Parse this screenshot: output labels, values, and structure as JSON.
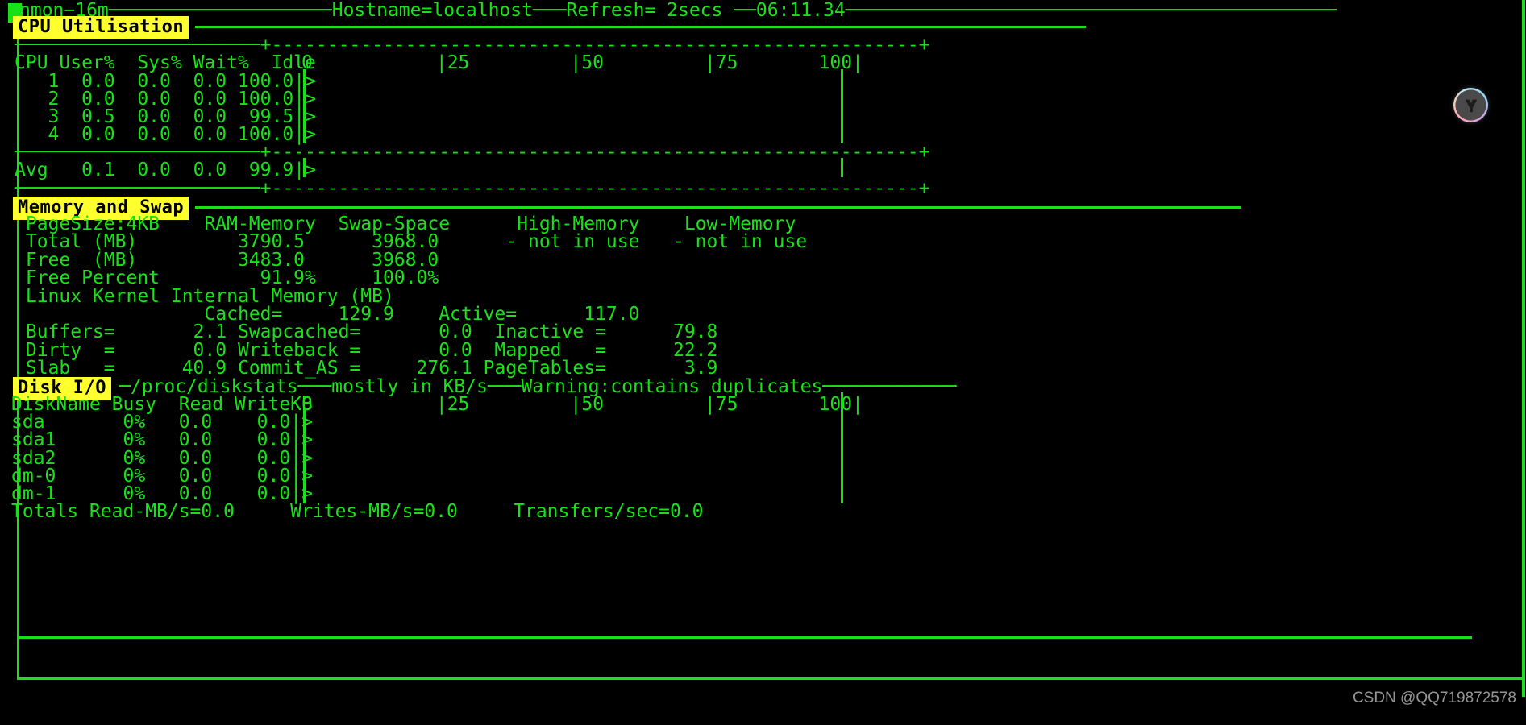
{
  "app": {
    "name": "nmon",
    "version_label": "nmon−16m",
    "header_line": "nmon−16m────────────────────Hostname=localhost───Refresh= 2secs ──06:11.34────────────────────────────────────────────",
    "hostname_label": "Hostname=localhost",
    "refresh_label": "Refresh= 2secs",
    "clock_label": "06:11.34",
    "colors": {
      "foreground": "#18e118",
      "background": "#000000",
      "banner_bg": "#ffff2e",
      "banner_fg": "#000000",
      "watermark": "#cfcfcf"
    }
  },
  "cpu_section": {
    "banner": "CPU Utilisation",
    "divider": "──────────────────────+----------------------------------------------------------+",
    "dashes_left": "----------------------+",
    "dashes_right": "-----------------------------------------------------------+",
    "header_cols": "CPU User%  Sys% Wait%  Idle",
    "scale_labels": [
      "0",
      "|25",
      "|50",
      "|75",
      "100|"
    ],
    "rows": [
      {
        "cpu": "   1",
        "user": "  0.0",
        "sys": "  0.0",
        "wait": "  0.0",
        "idle": " 100.0",
        "bar": ">"
      },
      {
        "cpu": "   2",
        "user": "  0.0",
        "sys": "  0.0",
        "wait": "  0.0",
        "idle": " 100.0",
        "bar": ">"
      },
      {
        "cpu": "   3",
        "user": "  0.5",
        "sys": "  0.0",
        "wait": "  0.0",
        "idle": "  99.5",
        "bar": ">"
      },
      {
        "cpu": "   4",
        "user": "  0.0",
        "sys": "  0.0",
        "wait": "  0.0",
        "idle": " 100.0",
        "bar": ">"
      }
    ],
    "avg_row": {
      "cpu": "Avg ",
      "user": "  0.1",
      "sys": "  0.0",
      "wait": "  0.0",
      "idle": "  99.9",
      "bar": ">"
    }
  },
  "memory_section": {
    "banner": "Memory and Swap",
    "col_headers": " PageSize:4KB    RAM-Memory  Swap-Space      High-Memory    Low-Memory",
    "rows": [
      " Total (MB)         3790.5      3968.0      - not in use   - not in use",
      " Free  (MB)         3483.0      3968.0",
      " Free Percent         91.9%     100.0%"
    ],
    "kernel_title": " Linux Kernel Internal Memory (MB)",
    "kernel_rows": [
      "                 Cached=     129.9    Active=      117.0",
      " Buffers=       2.1 Swapcached=       0.0  Inactive =      79.8",
      " Dirty  =       0.0 Writeback =       0.0  Mapped   =      22.2",
      " Slab   =      40.9 Commit_AS =     276.1 PageTables=       3.9"
    ],
    "values": {
      "page_size": "4KB",
      "ram_total_mb": "3790.5",
      "swap_total_mb": "3968.0",
      "ram_free_mb": "3483.0",
      "swap_free_mb": "3968.0",
      "ram_free_percent": "91.9%",
      "swap_free_percent": "100.0%",
      "high_memory": "- not in use",
      "low_memory": "- not in use",
      "cached": "129.9",
      "active": "117.0",
      "buffers": "2.1",
      "swapcached": "0.0",
      "inactive": "79.8",
      "dirty": "0.0",
      "writeback": "0.0",
      "mapped": "22.2",
      "slab": "40.9",
      "commit_as": "276.1",
      "pagetables": "3.9"
    }
  },
  "disk_section": {
    "banner": "Disk I/O",
    "banner_suffix": "─/proc/diskstats───mostly in KB/s───Warning:contains duplicates────────────",
    "source_label": "/proc/diskstats",
    "units_label": "mostly in KB/s",
    "warning_label": "Warning:contains duplicates",
    "header_cols": "DiskName Busy  Read WriteKB",
    "scale_labels": [
      "0",
      "|25",
      "|50",
      "|75",
      "100|"
    ],
    "rows": [
      {
        "name": "sda     ",
        "busy": "  0%",
        "read": "   0.0",
        "write": "    0.0",
        "bar": ">"
      },
      {
        "name": "sda1    ",
        "busy": "  0%",
        "read": "   0.0",
        "write": "    0.0",
        "bar": ">"
      },
      {
        "name": "sda2    ",
        "busy": "  0%",
        "read": "   0.0",
        "write": "    0.0",
        "bar": ">"
      },
      {
        "name": "dm-0    ",
        "busy": "  0%",
        "read": "   0.0",
        "write": "    0.0",
        "bar": ">"
      },
      {
        "name": "dm-1    ",
        "busy": "  0%",
        "read": "   0.0",
        "write": "    0.0",
        "bar": ">"
      }
    ],
    "totals_line": "Totals Read-MB/s=0.0     Writes-MB/s=0.0     Transfers/sec=0.0",
    "totals": {
      "read_mb_s": "0.0",
      "writes_mb_s": "0.0",
      "transfers_sec": "0.0"
    }
  },
  "float_button": {
    "icon": "tri-segment-logo-icon"
  },
  "watermark": {
    "text": "CSDN @QQ719872578"
  },
  "chart_data": {
    "type": "bar",
    "title": "CPU Utilisation",
    "xlabel": "",
    "ylabel": "",
    "xlim": [
      0,
      100
    ],
    "grid": false,
    "legend": "none",
    "categories": [
      "1",
      "2",
      "3",
      "4",
      "Avg"
    ],
    "series": [
      {
        "name": "User%",
        "values": [
          0.0,
          0.0,
          0.5,
          0.0,
          0.1
        ]
      },
      {
        "name": "Sys%",
        "values": [
          0.0,
          0.0,
          0.0,
          0.0,
          0.0
        ]
      },
      {
        "name": "Wait%",
        "values": [
          0.0,
          0.0,
          0.0,
          0.0,
          0.0
        ]
      },
      {
        "name": "Idle",
        "values": [
          100.0,
          100.0,
          99.5,
          100.0,
          99.9
        ]
      }
    ],
    "tick_labels": [
      "0",
      "25",
      "50",
      "75",
      "100"
    ]
  }
}
